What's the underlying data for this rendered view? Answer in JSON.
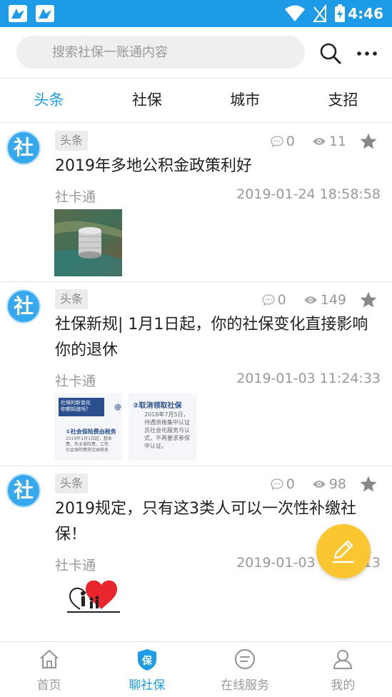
{
  "status_bar": {
    "time": "4:46"
  },
  "search": {
    "placeholder": "搜索社保一账通内容"
  },
  "tabs": [
    {
      "label": "头条",
      "active": true
    },
    {
      "label": "社保",
      "active": false
    },
    {
      "label": "城市",
      "active": false
    },
    {
      "label": "支招",
      "active": false
    }
  ],
  "articles": [
    {
      "avatar_text": "社",
      "tag": "头条",
      "comments": "0",
      "views": "11",
      "title": "2019年多地公积金政策利好",
      "source": "社卡通",
      "date": "2019-01-24 18:58:58"
    },
    {
      "avatar_text": "社",
      "tag": "头条",
      "comments": "0",
      "views": "149",
      "title": "社保新规| 1月1日起，你的社保变化直接影响你的退休",
      "source": "社卡通",
      "date": "2019-01-03 11:24:33",
      "thumb1": {
        "heading": "社保的新变化\n你都知道吗？",
        "item": "①社会保险费由税务",
        "body": "2019年1月1日起，基本\n费、失业保险费、工伤\n社会保险费将交由税务"
      },
      "thumb2": {
        "item": "②取消领取社保",
        "body": "2018年7月5日，\n待遇资格集中认证\n员社会化服务与认\n式，不再要求参保\n中认证。"
      }
    },
    {
      "avatar_text": "社",
      "tag": "头条",
      "comments": "0",
      "views": "98",
      "title": "2019规定，只有这3类人可以一次性补缴社保！",
      "source": "社卡通",
      "date": "2019-01-03 11:11:13"
    }
  ],
  "bottom_nav": [
    {
      "label": "首页",
      "icon": "home-icon",
      "active": false
    },
    {
      "label": "聊社保",
      "icon": "bao-shield-icon",
      "active": true
    },
    {
      "label": "在线服务",
      "icon": "chat-bubble-icon",
      "active": false
    },
    {
      "label": "我的",
      "icon": "user-icon",
      "active": false
    }
  ],
  "colors": {
    "primary": "#1e9be6",
    "fab": "#fbc630",
    "muted": "#999999"
  }
}
